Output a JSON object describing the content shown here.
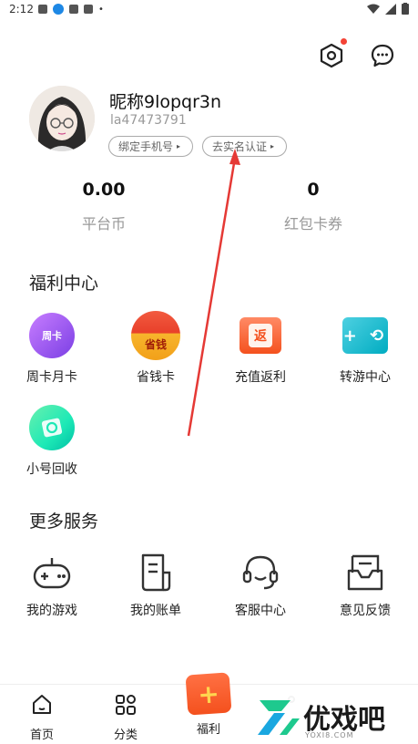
{
  "status_bar": {
    "time": "2:12"
  },
  "profile": {
    "nickname": "昵称9lopqr3n",
    "user_id": "la47473791",
    "bind_phone_label": "绑定手机号",
    "real_name_label": "去实名认证"
  },
  "stats": {
    "platform_coin_value": "0.00",
    "platform_coin_label": "平台币",
    "coupon_value": "0",
    "coupon_label": "红包卡券"
  },
  "welfare": {
    "title": "福利中心",
    "items": [
      {
        "label": "周卡月卡",
        "icon": "week-month-card-icon",
        "badge": "周卡"
      },
      {
        "label": "省钱卡",
        "icon": "save-money-card-icon",
        "badge": "省钱"
      },
      {
        "label": "充值返利",
        "icon": "recharge-rebate-icon",
        "badge": "返"
      },
      {
        "label": "转游中心",
        "icon": "transfer-game-icon",
        "badge": "+ ⟲"
      },
      {
        "label": "小号回收",
        "icon": "account-recycle-icon"
      }
    ]
  },
  "more_services": {
    "title": "更多服务",
    "items": [
      {
        "label": "我的游戏",
        "icon": "gamepad-icon"
      },
      {
        "label": "我的账单",
        "icon": "bill-icon"
      },
      {
        "label": "客服中心",
        "icon": "headset-icon"
      },
      {
        "label": "意见反馈",
        "icon": "feedback-icon"
      }
    ]
  },
  "bottom_nav": {
    "items": [
      {
        "label": "首页",
        "icon": "home-icon"
      },
      {
        "label": "分类",
        "icon": "category-icon"
      },
      {
        "label": "福利",
        "icon": "welfare-icon",
        "badge": "+"
      }
    ]
  },
  "watermark": {
    "text": "优戏吧",
    "sub": "YOXI8.COM"
  },
  "colors": {
    "accent_red": "#f44336",
    "annotation_arrow": "#e53935"
  }
}
